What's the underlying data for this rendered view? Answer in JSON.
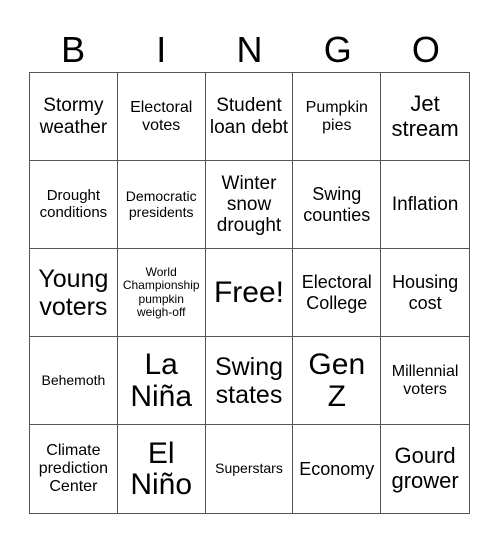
{
  "header": {
    "letters": [
      "B",
      "I",
      "N",
      "G",
      "O"
    ]
  },
  "cells": [
    "Stormy weather",
    "Electoral votes",
    "Student loan debt",
    "Pumpkin pies",
    "Jet stream",
    "Drought conditions",
    "Democratic presidents",
    "Winter snow drought",
    "Swing counties",
    "Inflation",
    "Young voters",
    "World Championship pumpkin weigh-off",
    "Free!",
    "Electoral College",
    "Housing cost",
    "Behemoth",
    "La Niña",
    "Swing states",
    "Gen Z",
    "Millennial voters",
    "Climate prediction Center",
    "El Niño",
    "Superstars",
    "Economy",
    "Gourd grower"
  ]
}
